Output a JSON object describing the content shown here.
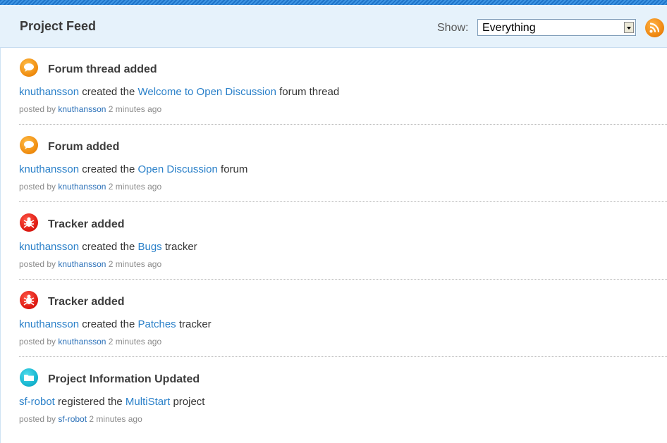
{
  "header": {
    "title": "Project Feed",
    "show_label": "Show:",
    "filter_value": "Everything",
    "rss_icon": "rss-icon"
  },
  "feed": {
    "items": [
      {
        "icon": "speech-bubble-icon",
        "title": "Forum thread added",
        "actor": "knuthansson",
        "verb": " created the ",
        "target": "Welcome to Open Discussion",
        "suffix": " forum thread",
        "posted_by_label": "posted by ",
        "poster": "knuthansson",
        "time": " 2 minutes ago"
      },
      {
        "icon": "speech-bubble-icon",
        "title": "Forum added",
        "actor": "knuthansson",
        "verb": " created the ",
        "target": "Open Discussion",
        "suffix": " forum",
        "posted_by_label": "posted by ",
        "poster": "knuthansson",
        "time": " 2 minutes ago"
      },
      {
        "icon": "bug-icon",
        "title": "Tracker added",
        "actor": "knuthansson",
        "verb": " created the ",
        "target": "Bugs",
        "suffix": " tracker",
        "posted_by_label": "posted by ",
        "poster": "knuthansson",
        "time": " 2 minutes ago"
      },
      {
        "icon": "bug-icon",
        "title": "Tracker added",
        "actor": "knuthansson",
        "verb": " created the ",
        "target": "Patches",
        "suffix": " tracker",
        "posted_by_label": "posted by ",
        "poster": "knuthansson",
        "time": " 2 minutes ago"
      },
      {
        "icon": "folder-icon",
        "title": "Project Information Updated",
        "actor": "sf-robot",
        "verb": " registered the ",
        "target": "MultiStart",
        "suffix": " project",
        "posted_by_label": "posted by ",
        "poster": "sf-robot",
        "time": " 2 minutes ago"
      }
    ]
  }
}
